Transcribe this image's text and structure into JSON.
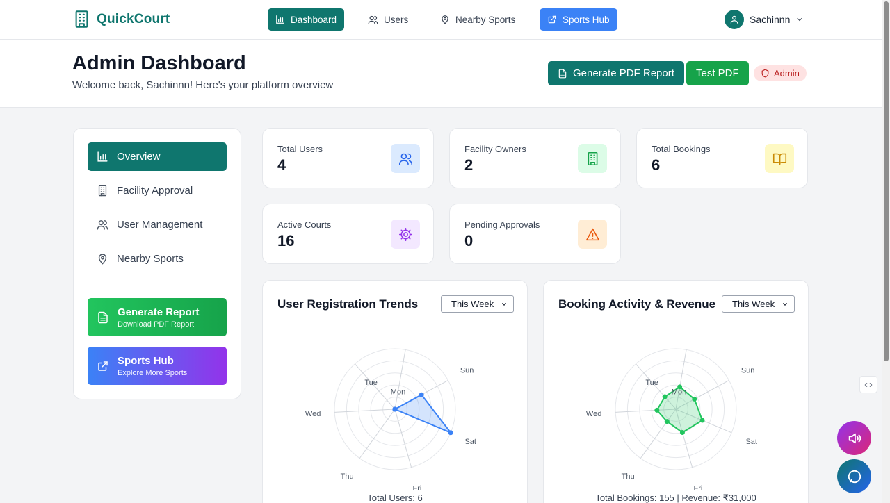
{
  "app": {
    "name": "QuickCourt"
  },
  "nav": {
    "items": [
      {
        "label": "Dashboard",
        "icon": "bar-chart-icon"
      },
      {
        "label": "Users",
        "icon": "users-icon"
      },
      {
        "label": "Nearby Sports",
        "icon": "map-pin-icon"
      },
      {
        "label": "Sports Hub",
        "icon": "external-link-icon"
      }
    ],
    "user": {
      "name": "Sachinnn"
    }
  },
  "header": {
    "title": "Admin Dashboard",
    "subtitle": "Welcome back, Sachinnn! Here's your platform overview",
    "generate_pdf_label": "Generate PDF Report",
    "test_pdf_label": "Test PDF",
    "role_badge": "Admin"
  },
  "sidebar": {
    "items": [
      {
        "label": "Overview",
        "icon": "bar-chart-icon"
      },
      {
        "label": "Facility Approval",
        "icon": "building-icon"
      },
      {
        "label": "User Management",
        "icon": "users-icon"
      },
      {
        "label": "Nearby Sports",
        "icon": "map-pin-icon"
      }
    ],
    "report_card": {
      "title": "Generate Report",
      "subtitle": "Download PDF Report"
    },
    "hub_card": {
      "title": "Sports Hub",
      "subtitle": "Explore More Sports"
    }
  },
  "stats": [
    {
      "label": "Total Users",
      "value": "4",
      "icon": "users-icon",
      "color": "#2563eb",
      "bg": "#dbeafe"
    },
    {
      "label": "Facility Owners",
      "value": "2",
      "icon": "building-icon",
      "color": "#16a34a",
      "bg": "#dcfce7"
    },
    {
      "label": "Total Bookings",
      "value": "6",
      "icon": "book-open-icon",
      "color": "#ca8a04",
      "bg": "#fef9c3"
    },
    {
      "label": "Active Courts",
      "value": "16",
      "icon": "gear-icon",
      "color": "#9333ea",
      "bg": "#f3e8ff"
    },
    {
      "label": "Pending Approvals",
      "value": "0",
      "icon": "warning-icon",
      "color": "#ea580c",
      "bg": "#ffedd5"
    }
  ],
  "charts": {
    "registration": {
      "title": "User Registration Trends",
      "select_value": "This Week",
      "footer": "Total Users: 6"
    },
    "bookings": {
      "title": "Booking Activity & Revenue",
      "select_value": "This Week",
      "footer": "Total Bookings: 155 | Revenue: ₹31,000"
    }
  },
  "chart_data": [
    {
      "type": "radar",
      "title": "User Registration Trends",
      "categories": [
        "Mon",
        "Tue",
        "Wed",
        "Thu",
        "Fri",
        "Sat",
        "Sun"
      ],
      "series": [
        {
          "values": [
            0,
            0,
            0,
            0,
            0,
            4,
            2
          ]
        }
      ],
      "color": "#3b82f6",
      "rlim": [
        0,
        4
      ]
    },
    {
      "type": "radar",
      "title": "Booking Activity & Revenue",
      "categories": [
        "Mon",
        "Tue",
        "Wed",
        "Thu",
        "Fri",
        "Sat",
        "Sun"
      ],
      "series": [
        {
          "values": [
            30,
            22,
            25,
            20,
            32,
            38,
            28
          ]
        }
      ],
      "color": "#22c55e",
      "rlim": [
        0,
        80
      ]
    }
  ]
}
